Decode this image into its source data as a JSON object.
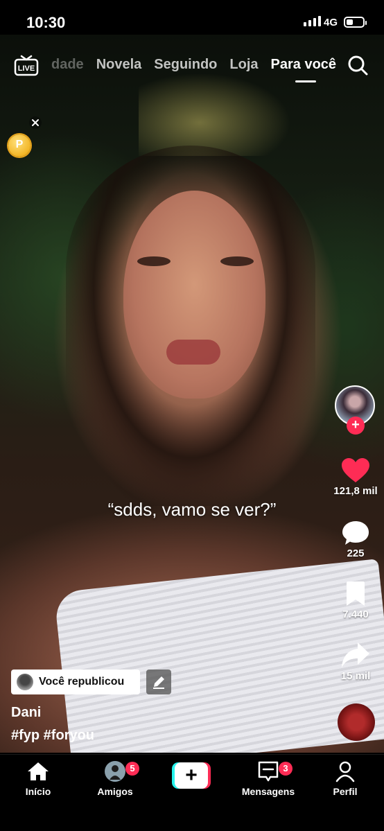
{
  "status_bar": {
    "time": "10:30",
    "network": "4G"
  },
  "top_tabs": {
    "items": [
      {
        "label": "dade",
        "state": "faded"
      },
      {
        "label": "Novela",
        "state": "inactive"
      },
      {
        "label": "Seguindo",
        "state": "inactive"
      },
      {
        "label": "Loja",
        "state": "inactive"
      },
      {
        "label": "Para você",
        "state": "active"
      }
    ],
    "live_icon_text": "LIVE"
  },
  "video": {
    "caption_overlay": "“sdds, vamo se ver?”"
  },
  "side_actions": {
    "likes": "121,8 mil",
    "comments": "225",
    "saves": "7.440",
    "shares": "15 mil",
    "follow_symbol": "+"
  },
  "post": {
    "repost_label": "Você republicou",
    "author": "Dani",
    "hashtags": "#fyp #foryou"
  },
  "bottom_nav": {
    "items": [
      {
        "label": "Início",
        "active": true
      },
      {
        "label": "Amigos",
        "badge": "5"
      },
      {
        "label": "Mensagens",
        "badge": "3"
      },
      {
        "label": "Perfil"
      }
    ],
    "create_symbol": "+"
  },
  "colors": {
    "accent": "#fe2c55",
    "cyan": "#25f4ee",
    "coin": "#f2b526"
  }
}
